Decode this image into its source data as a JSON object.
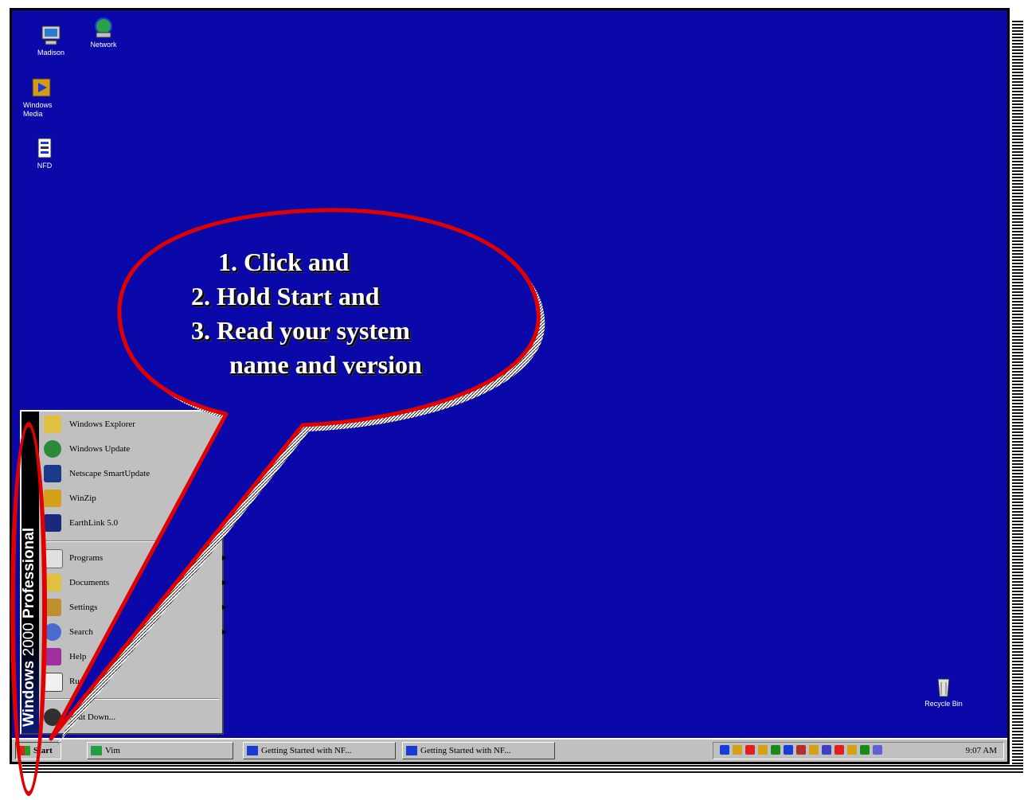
{
  "desktop": {
    "icons": [
      {
        "label": "Madison",
        "icon": "computer-icon"
      },
      {
        "label": "Network",
        "icon": "network-icon"
      },
      {
        "label": "Windows Media",
        "icon": "media-player-icon"
      },
      {
        "label": "NFD",
        "icon": "file-icon"
      },
      {
        "label": "Recycle Bin",
        "icon": "recycle-bin-icon"
      }
    ],
    "background_color": "#0a08a8"
  },
  "start_menu": {
    "banner": {
      "prefix": "Windows",
      "version": "2000",
      "edition": "Professional"
    },
    "pinned": [
      {
        "label": "Windows Explorer",
        "icon": "explorer-icon"
      },
      {
        "label": "Windows Update",
        "icon": "globe-icon"
      },
      {
        "label": "Netscape SmartUpdate",
        "icon": "netscape-icon"
      },
      {
        "label": "WinZip",
        "icon": "winzip-icon"
      },
      {
        "label": "EarthLink 5.0",
        "icon": "earthlink-icon"
      }
    ],
    "main": [
      {
        "label": "Programs",
        "icon": "programs-icon",
        "submenu": true
      },
      {
        "label": "Documents",
        "icon": "documents-icon",
        "submenu": true
      },
      {
        "label": "Settings",
        "icon": "settings-icon",
        "submenu": true
      },
      {
        "label": "Search",
        "icon": "search-icon",
        "submenu": true
      },
      {
        "label": "Help",
        "icon": "help-icon",
        "submenu": false
      },
      {
        "label": "Run...",
        "icon": "run-icon",
        "submenu": false
      }
    ],
    "shutdown": {
      "label": "Shut Down...",
      "icon": "shutdown-icon"
    }
  },
  "taskbar": {
    "start_label": "Start",
    "buttons": [
      {
        "label": "Vim",
        "icon": "vim-icon"
      },
      {
        "label": "Getting Started with NF...",
        "icon": "word-doc-icon"
      },
      {
        "label": "Getting Started with NF...",
        "icon": "word-doc-icon"
      }
    ],
    "tray_icon_colors": [
      "#1a3bd6",
      "#d4a017",
      "#e02020",
      "#d4a017",
      "#1a8a1a",
      "#1a3bd6",
      "#b03030",
      "#d4a017",
      "#4040c0",
      "#e02020",
      "#d4a017",
      "#1a8a1a",
      "#6060d0"
    ],
    "clock": "9:07 AM"
  },
  "callout": {
    "lines": [
      "1. Click  and",
      "2. Hold Start and",
      "3. Read your system",
      "    name and version"
    ],
    "color": "#e00000"
  }
}
